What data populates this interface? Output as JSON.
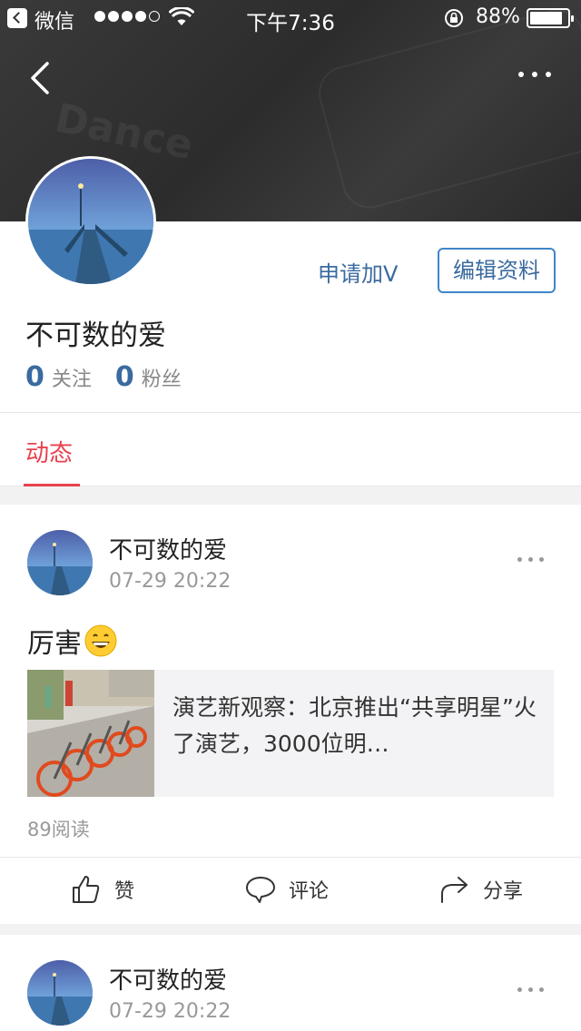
{
  "status_bar": {
    "carrier": "微信",
    "time": "下午7:36",
    "battery_pct": "88%",
    "battery_level": 0.88
  },
  "profile": {
    "apply_v": "申请加V",
    "edit_profile": "编辑资料",
    "nickname": "不可数的爱",
    "following_count": "0",
    "following_label": "关注",
    "fans_count": "0",
    "fans_label": "粉丝"
  },
  "tabs": [
    {
      "label": "动态",
      "active": true
    }
  ],
  "posts": [
    {
      "author": "不可数的爱",
      "time": "07-29 20:22",
      "text": "厉害",
      "emoji": "grinning-face",
      "link_title": "演艺新观察：北京推出“共享明星”火了演艺，3000位明…",
      "reads": "89阅读",
      "actions": {
        "like": "赞",
        "comment": "评论",
        "share": "分享"
      }
    },
    {
      "author": "不可数的爱",
      "time": "07-29 20:22"
    }
  ],
  "colors": {
    "accent_red": "#e8414f",
    "link_blue": "#3a6aa0",
    "button_border": "#3e86c8"
  },
  "icons": [
    "back-icon",
    "more-icon",
    "like-icon",
    "comment-icon",
    "share-icon",
    "wifi-icon",
    "rotation-lock-icon",
    "battery-icon"
  ]
}
